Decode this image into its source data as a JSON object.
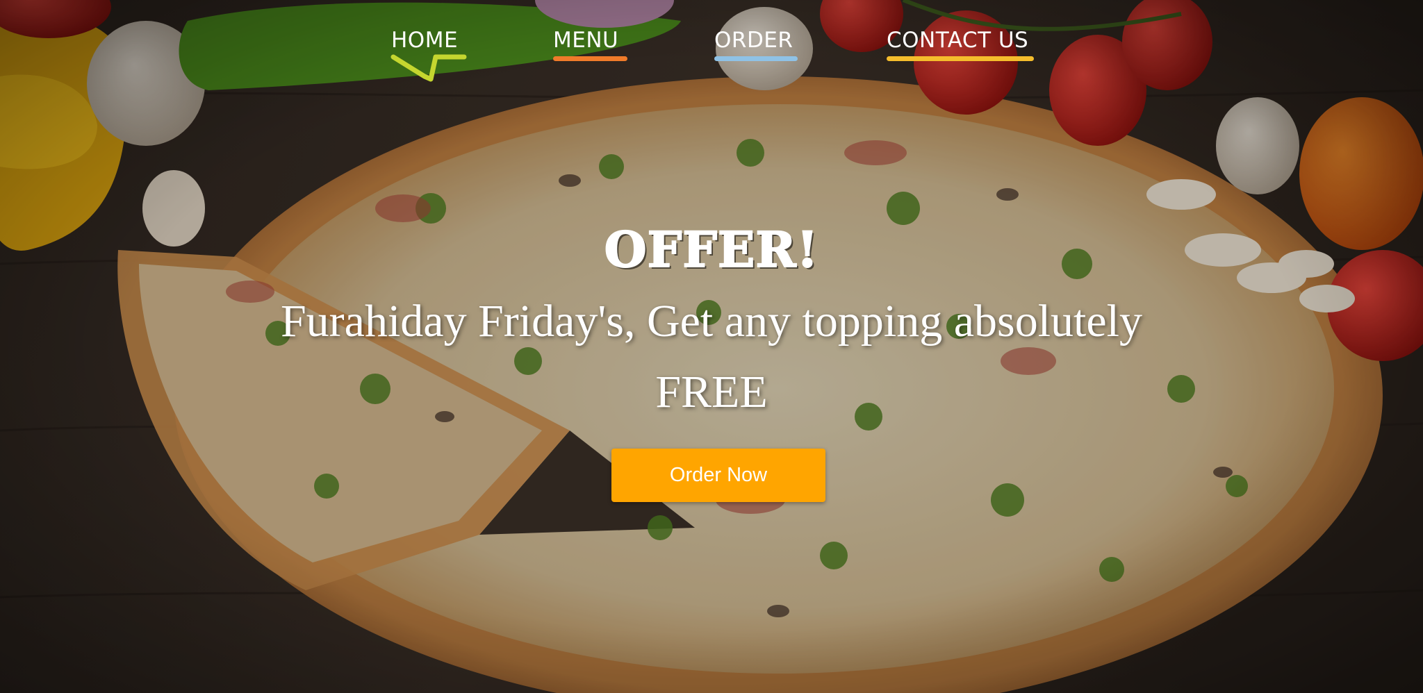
{
  "nav": {
    "items": [
      {
        "label": "HOME",
        "accent": "#c5d62f"
      },
      {
        "label": "MENU",
        "accent": "#f07b2a"
      },
      {
        "label": "ORDER",
        "accent": "#8fc2e6"
      },
      {
        "label": "CONTACT US",
        "accent": "#f5bd2c"
      }
    ]
  },
  "hero": {
    "title": "OFFER!",
    "subtitle": "Furahiday Friday's, Get any topping absolutely FREE",
    "cta_label": "Order Now",
    "cta_color": "#ffa500"
  },
  "background": {
    "description_icon": "pizza-photo"
  }
}
